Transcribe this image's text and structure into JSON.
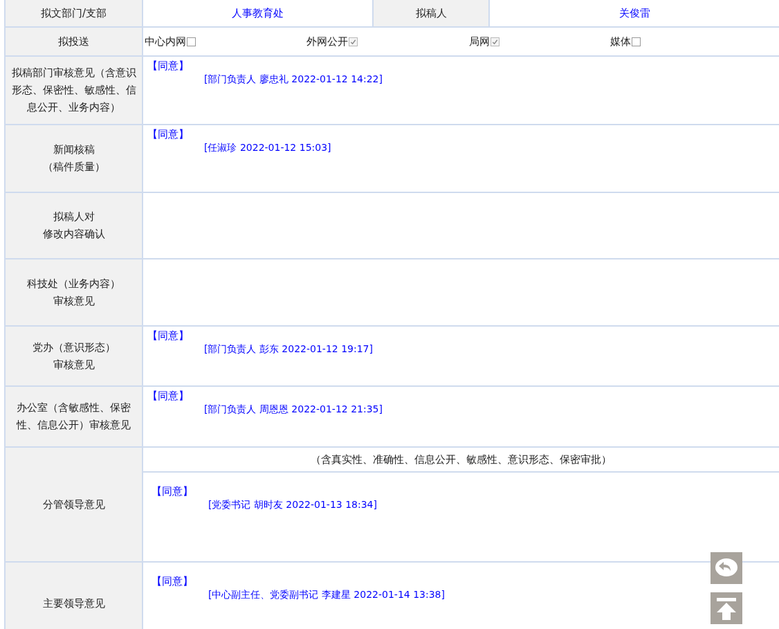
{
  "header": {
    "dept_label": "拟文部门/支部",
    "dept": "人事教育处",
    "drafter_label": "拟稿人",
    "drafter": "关俊雷"
  },
  "distribution": {
    "label": "拟投送",
    "options": [
      {
        "label": "中心内网",
        "checked": false
      },
      {
        "label": "外网公开",
        "checked": true
      },
      {
        "label": "局网",
        "checked": true
      },
      {
        "label": "媒体",
        "checked": false
      }
    ]
  },
  "rows": [
    {
      "label": [
        "拟稿部门审核意见（含意识形态、保密性、敏感性、信息公开、业务内容）"
      ],
      "opinions": [
        {
          "decision": "【同意】",
          "signature": "[部门负责人 廖忠礼 2022-01-12 14:22]"
        }
      ]
    },
    {
      "label": [
        "新闻核稿",
        "（稿件质量）"
      ],
      "opinions": [
        {
          "decision": "【同意】",
          "signature": "[任淑珍 2022-01-12 15:03]"
        }
      ]
    },
    {
      "label": [
        "拟稿人对",
        "修改内容确认"
      ],
      "opinions": []
    },
    {
      "label": [
        "科技处（业务内容）",
        "审核意见"
      ],
      "opinions": []
    },
    {
      "label": [
        "党办（意识形态）",
        "审核意见"
      ],
      "opinions": [
        {
          "decision": "【同意】",
          "signature": "[部门负责人 彭东 2022-01-12 19:17]"
        }
      ]
    },
    {
      "label": [
        "办公室（含敏感性、保密性、信息公开）审核意见"
      ],
      "opinions": [
        {
          "decision": "【同意】",
          "signature": "[部门负责人 周恩恩 2022-01-12 21:35]"
        }
      ]
    },
    {
      "label": [
        "分管领导意见"
      ],
      "note": "（含真实性、准确性、信息公开、敏感性、意识形态、保密审批）",
      "opinions": [
        {
          "decision": "【同意】",
          "signature": "[党委书记 胡时友 2022-01-13 18:34]"
        }
      ]
    },
    {
      "label": [
        "主要领导意见"
      ],
      "opinions": [
        {
          "decision": "【同意】",
          "signature": "[中心副主任、党委副书记 李建星 2022-01-14 13:38]"
        }
      ]
    }
  ]
}
